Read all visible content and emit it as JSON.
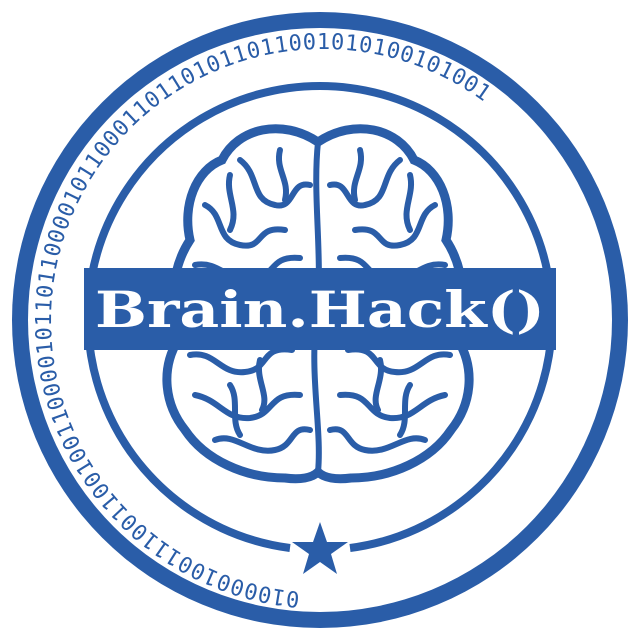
{
  "logo": {
    "title": "Brain.Hack()",
    "binary_ring": "0100001001110011001001100001011011000010110001101101011011001010100101001",
    "colors": {
      "primary": "#2a5da8",
      "background": "#ffffff"
    },
    "icons": [
      "brain-icon",
      "star-icon"
    ]
  }
}
